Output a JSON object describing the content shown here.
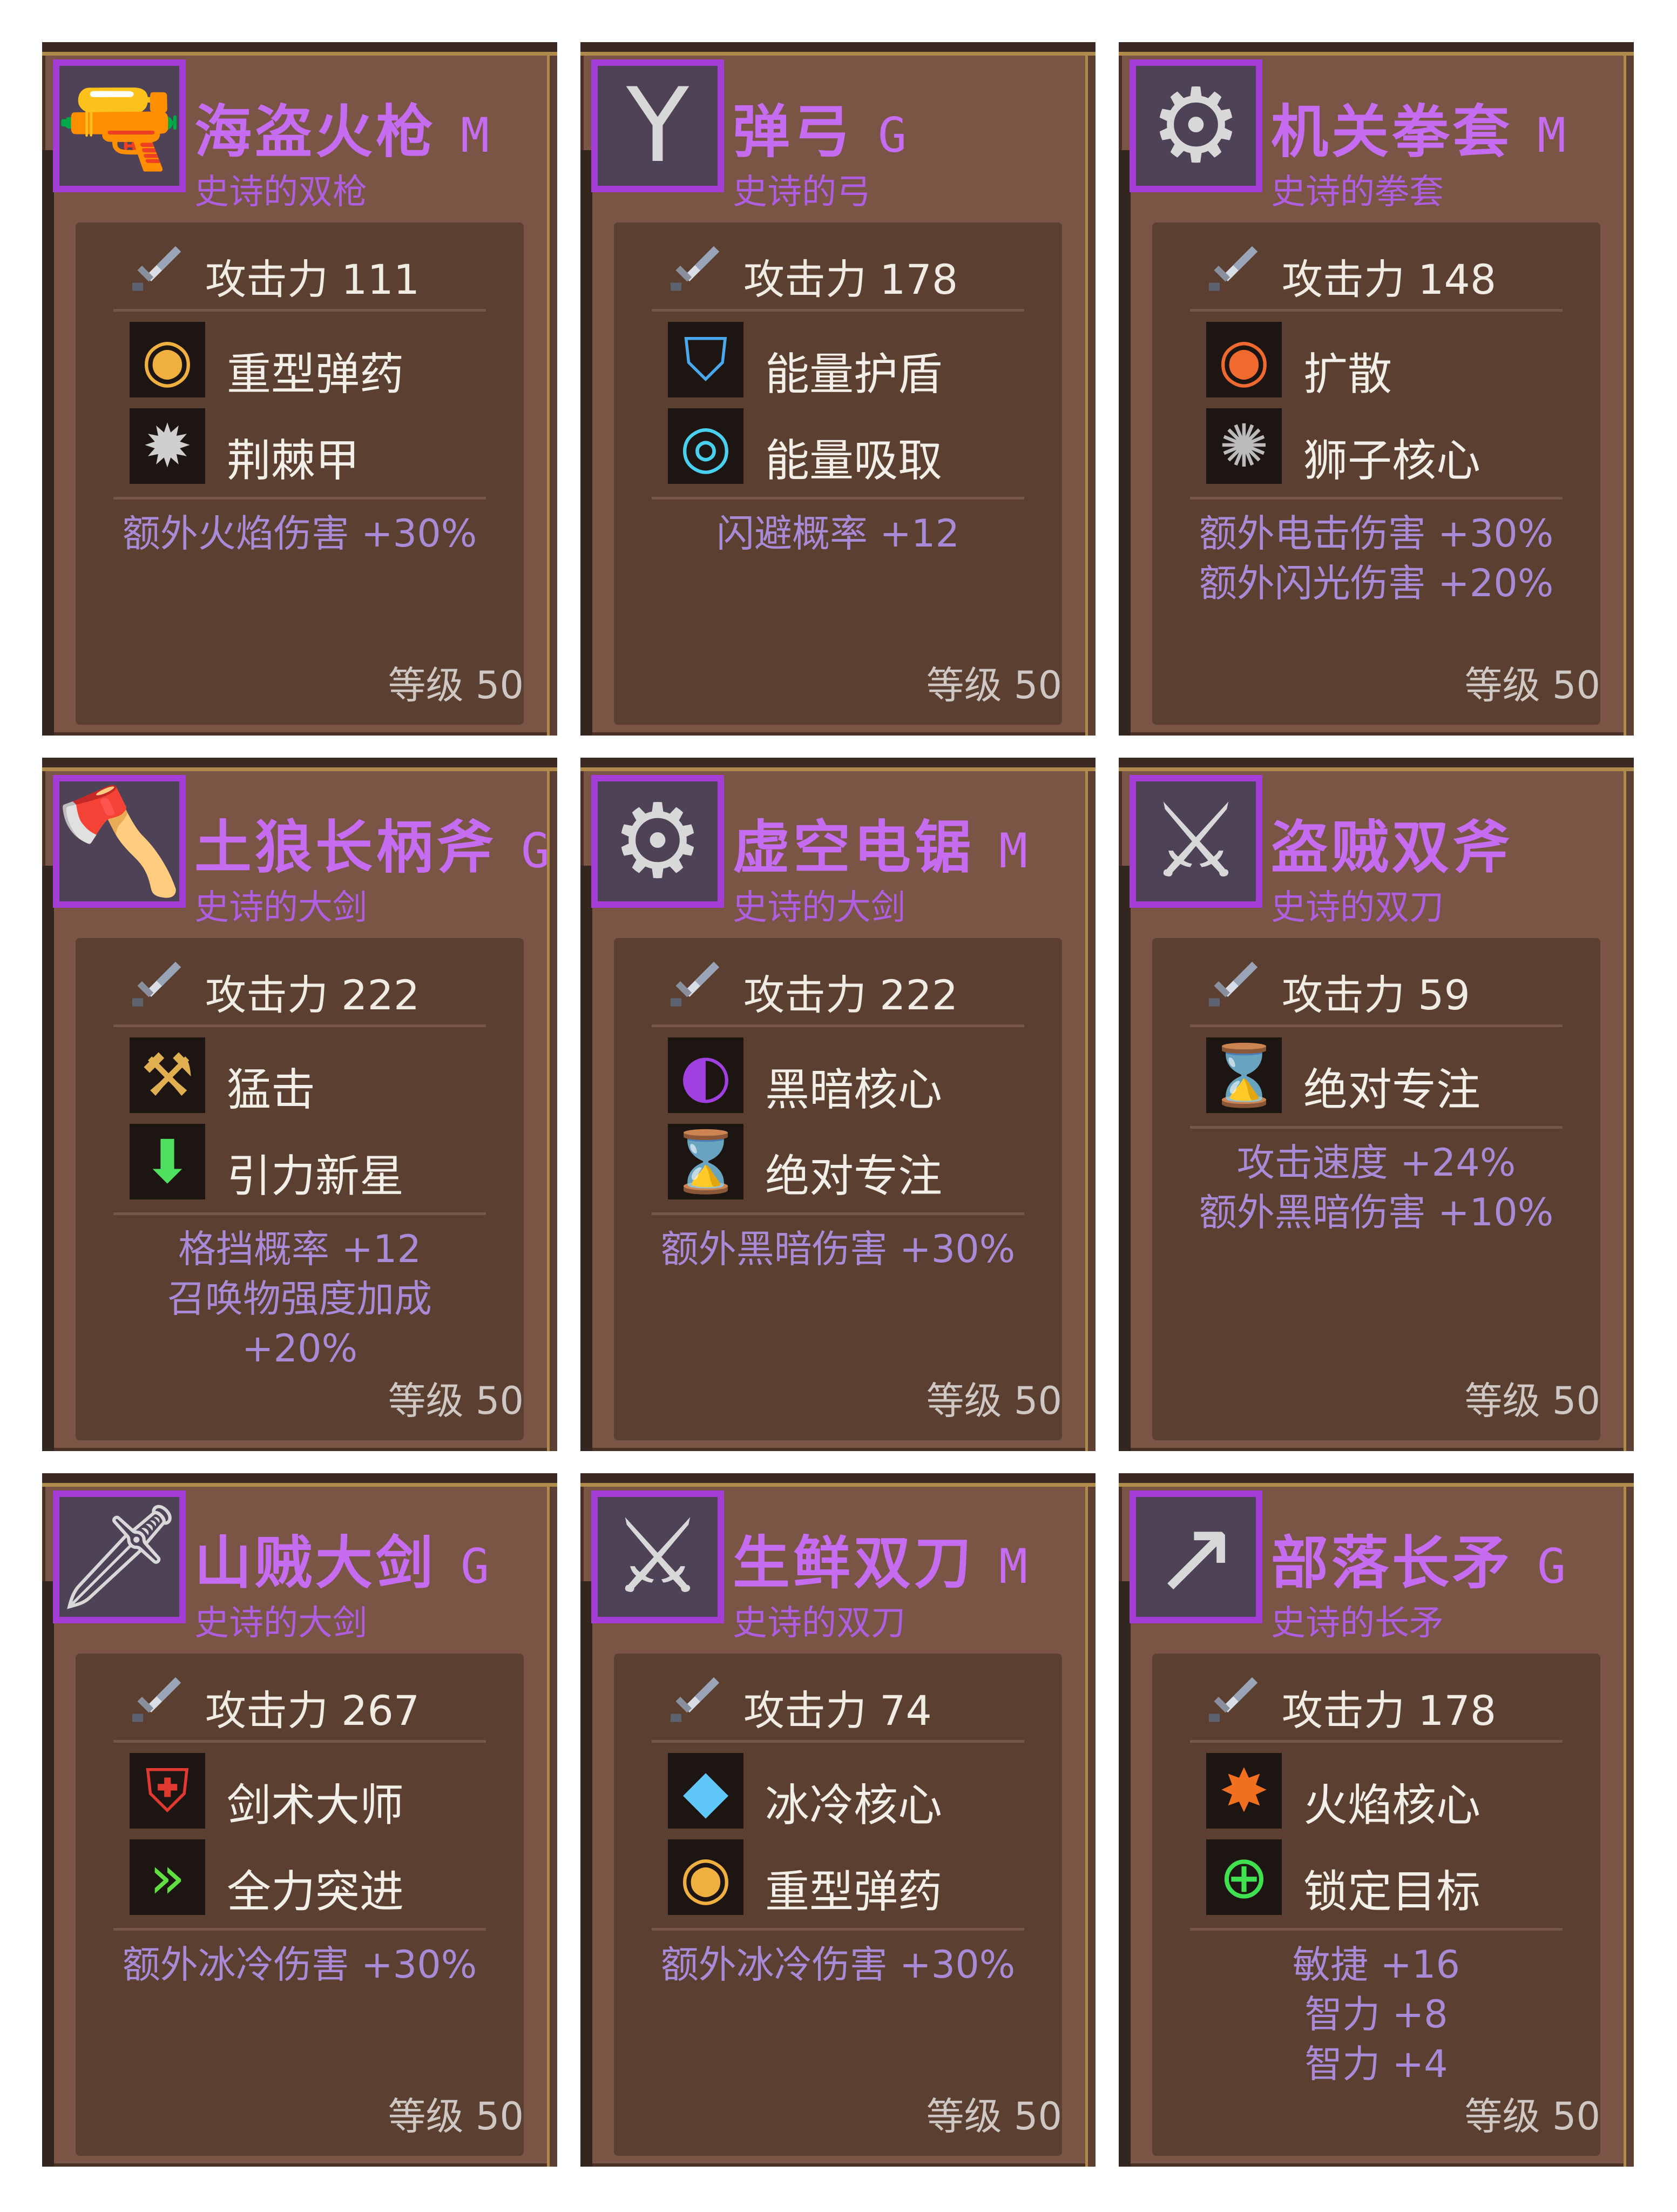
{
  "attack_label": "攻击力",
  "level_label": "等级",
  "colors": {
    "card_bg": "#7a5545",
    "panel_bg": "#5b3f31",
    "name_purple": "#c56cf0",
    "bonus_purple": "#a98ad6",
    "icon_frame": "#a43dd6",
    "gold_trim": "#b08a4a"
  },
  "cards": [
    {
      "name": "海盗火枪",
      "grade": "M",
      "type": "史诗的双枪",
      "icon": "pistols-icon",
      "icon_glyph": "🔫",
      "attack": "111",
      "skills": [
        {
          "name": "重型弹药",
          "icon": "bullet-icon",
          "glyph": "◉",
          "color": "#f0b040"
        },
        {
          "name": "荆棘甲",
          "icon": "spike-gear-icon",
          "glyph": "✹",
          "color": "#cfcfcf"
        }
      ],
      "bonuses": [
        "额外火焰伤害 +30%"
      ],
      "level": "50"
    },
    {
      "name": "弹弓",
      "grade": "G",
      "type": "史诗的弓",
      "icon": "slingshot-icon",
      "icon_glyph": "Y",
      "attack": "178",
      "skills": [
        {
          "name": "能量护盾",
          "icon": "energy-shield-icon",
          "glyph": "⛉",
          "color": "#4aa8ef"
        },
        {
          "name": "能量吸取",
          "icon": "energy-drain-icon",
          "glyph": "◎",
          "color": "#4ad0ef"
        }
      ],
      "bonuses": [
        "闪避概率 +12"
      ],
      "level": "50"
    },
    {
      "name": "机关拳套",
      "grade": "M",
      "type": "史诗的拳套",
      "icon": "gauntlet-icon",
      "icon_glyph": "⚙",
      "attack": "148",
      "skills": [
        {
          "name": "扩散",
          "icon": "spread-ring-icon",
          "glyph": "◉",
          "color": "#f06a30"
        },
        {
          "name": "狮子核心",
          "icon": "lion-core-icon",
          "glyph": "✺",
          "color": "#bbbbbb"
        }
      ],
      "bonuses": [
        "额外电击伤害 +30%",
        "额外闪光伤害 +20%"
      ],
      "level": "50"
    },
    {
      "name": "土狼长柄斧",
      "grade": "G",
      "type": "史诗的大剑",
      "icon": "halberd-icon",
      "icon_glyph": "🪓",
      "attack": "222",
      "skills": [
        {
          "name": "猛击",
          "icon": "hammer-strike-icon",
          "glyph": "⚒",
          "color": "#e0b050"
        },
        {
          "name": "引力新星",
          "icon": "gravity-nova-icon",
          "glyph": "⬇",
          "color": "#50e060"
        }
      ],
      "bonuses": [
        "格挡概率 +12",
        "召唤物强度加成",
        "+20%"
      ],
      "level": "50"
    },
    {
      "name": "虚空电锯",
      "grade": "M",
      "type": "史诗的大剑",
      "icon": "chainsaw-icon",
      "icon_glyph": "⚙",
      "attack": "222",
      "skills": [
        {
          "name": "黑暗核心",
          "icon": "dark-core-icon",
          "glyph": "◐",
          "color": "#a040e0"
        },
        {
          "name": "绝对专注",
          "icon": "hourglass-icon",
          "glyph": "⌛",
          "color": "#50c8f0"
        }
      ],
      "bonuses": [
        "额外黑暗伤害 +30%"
      ],
      "level": "50"
    },
    {
      "name": "盗贼双斧",
      "grade": "",
      "type": "史诗的双刀",
      "icon": "twin-axes-icon",
      "icon_glyph": "⚔",
      "attack": "59",
      "skills": [
        {
          "name": "绝对专注",
          "icon": "hourglass-icon",
          "glyph": "⌛",
          "color": "#50c8f0"
        }
      ],
      "bonuses": [
        "攻击速度 +24%",
        "额外黑暗伤害 +10%"
      ],
      "level": "50"
    },
    {
      "name": "山贼大剑",
      "grade": "G",
      "type": "史诗的大剑",
      "icon": "greatsword-icon",
      "icon_glyph": "🗡",
      "attack": "267",
      "skills": [
        {
          "name": "剑术大师",
          "icon": "sword-master-icon",
          "glyph": "⛨",
          "color": "#e03a30"
        },
        {
          "name": "全力突进",
          "icon": "dash-icon",
          "glyph": "»",
          "color": "#60e040"
        }
      ],
      "bonuses": [
        "额外冰冷伤害 +30%"
      ],
      "level": "50"
    },
    {
      "name": "生鲜双刀",
      "grade": "M",
      "type": "史诗的双刀",
      "icon": "twin-blades-icon",
      "icon_glyph": "⚔",
      "attack": "74",
      "skills": [
        {
          "name": "冰冷核心",
          "icon": "ice-core-icon",
          "glyph": "◆",
          "color": "#60c8f8"
        },
        {
          "name": "重型弹药",
          "icon": "bullet-icon",
          "glyph": "◉",
          "color": "#f0b040"
        }
      ],
      "bonuses": [
        "额外冰冷伤害 +30%"
      ],
      "level": "50"
    },
    {
      "name": "部落长矛",
      "grade": "G",
      "type": "史诗的长矛",
      "icon": "spear-icon",
      "icon_glyph": "↗",
      "attack": "178",
      "skills": [
        {
          "name": "火焰核心",
          "icon": "fire-core-icon",
          "glyph": "✸",
          "color": "#f07020"
        },
        {
          "name": "锁定目标",
          "icon": "target-lock-icon",
          "glyph": "⊕",
          "color": "#40e050"
        }
      ],
      "bonuses": [
        "敏捷 +16",
        "智力 +8",
        "智力 +4"
      ],
      "level": "50"
    }
  ]
}
